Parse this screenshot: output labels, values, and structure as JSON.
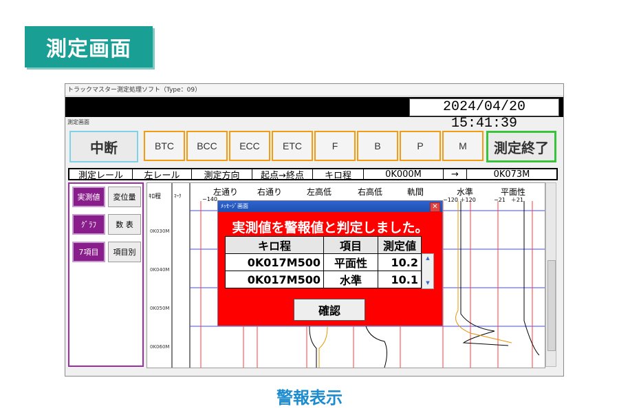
{
  "page": {
    "badge": "測定画面",
    "caption": "警報表示"
  },
  "window": {
    "title": "トラックマスター測定処理ソフト（Type：09）",
    "datetime": "2024/04/20 15:41:39",
    "screen_label": "測定画面"
  },
  "toolbar": {
    "pause_label": "中断",
    "end_label": "測定終了",
    "buttons": [
      "BTC",
      "BCC",
      "ECC",
      "ETC",
      "F",
      "B",
      "P",
      "M"
    ]
  },
  "infobar": {
    "rail_label": "測定レール",
    "rail_value": "左レール",
    "direction_label": "測定方向",
    "direction_value": "起点→終点",
    "km_label": "キロ程",
    "km_start": "0K000M",
    "arrow": "→",
    "km_end": "0K073M"
  },
  "left_panel": {
    "actual_value": "実測値",
    "displacement": "変位量",
    "graph": "ｸﾞﾗﾌ",
    "table": "数 表",
    "seven_items": "7項目",
    "per_item": "項目別"
  },
  "chart": {
    "row_header": "ｷﾛ程",
    "mark_header": "ﾏｰｸ",
    "columns": [
      {
        "name": "左通り",
        "sub": "−140"
      },
      {
        "name": "右通り",
        "sub": ""
      },
      {
        "name": "左高低",
        "sub": ""
      },
      {
        "name": "右高低",
        "sub": ""
      },
      {
        "name": "軌間",
        "sub": ""
      },
      {
        "name": "水準",
        "sub": "−120 ＋120"
      },
      {
        "name": "平面性",
        "sub": "−21　＋21"
      }
    ],
    "rows": [
      "0K030M",
      "0K040M",
      "0K050M",
      "0K060M"
    ]
  },
  "dialog": {
    "title": "ﾒｯｾｰｼﾞ画面",
    "close": "✕",
    "message": "実測値を警報値と判定しました。",
    "headers": [
      "キロ程",
      "項目",
      "測定値"
    ],
    "rows": [
      {
        "km": "0K017M500",
        "item": "平面性",
        "value": "10.2"
      },
      {
        "km": "0K017M500",
        "item": "水準",
        "value": "10.1"
      }
    ],
    "confirm": "確認"
  },
  "colors": {
    "badge": "#1a9f95",
    "caption": "#1d8ccf",
    "dialog_bg": "#ff0000",
    "left_panel_border": "#9b2ea0",
    "button_border": "#f39c12",
    "end_button_border": "#38c33a"
  }
}
